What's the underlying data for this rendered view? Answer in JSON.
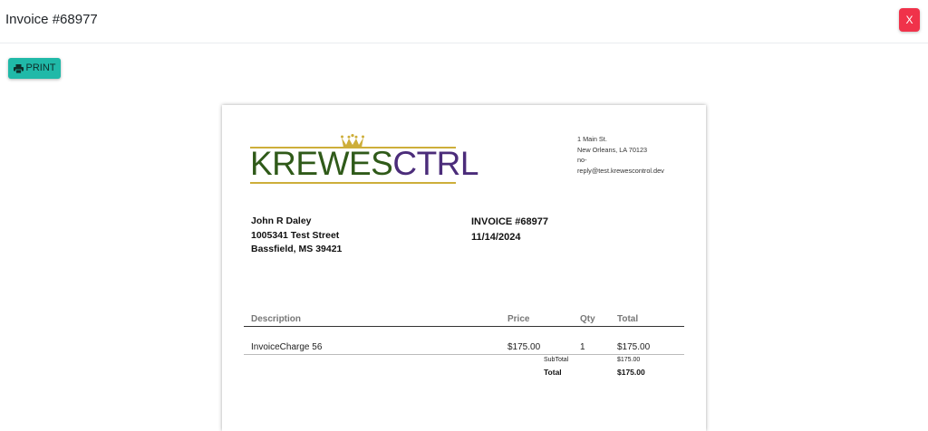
{
  "header": {
    "title": "Invoice #68977",
    "close_label": "X"
  },
  "toolbar": {
    "print_label": "PRINT",
    "print_icon": "printer-icon"
  },
  "brand": {
    "logo_part1": "KREWES",
    "logo_part2": "CTRL",
    "logo_color_1": "#2f5a19",
    "logo_color_2": "#4b2c7a",
    "accent_gold": "#cdae3a",
    "logo_icon": "crown-icon"
  },
  "company": {
    "address_line1": "1 Main St.",
    "address_line2": "New Orleans, LA 70123",
    "email_line1": "no-",
    "email_line2": "reply@test.krewescontrol.dev"
  },
  "customer": {
    "name": "John R Daley",
    "street": "1005341 Test Street",
    "city": "Bassfield, MS 39421"
  },
  "invoice": {
    "number": "INVOICE #68977",
    "date": "11/14/2024"
  },
  "table": {
    "headers": {
      "description": "Description",
      "price": "Price",
      "qty": "Qty",
      "total": "Total"
    },
    "rows": [
      {
        "description": "InvoiceCharge 56",
        "price": "$175.00",
        "qty": "1",
        "total": "$175.00"
      }
    ]
  },
  "summary": {
    "subtotal_label": "SubTotal",
    "subtotal_value": "$175.00",
    "total_label": "Total",
    "total_value": "$175.00"
  },
  "colors": {
    "close_button": "#f0324a",
    "print_button": "#20b9a8"
  }
}
